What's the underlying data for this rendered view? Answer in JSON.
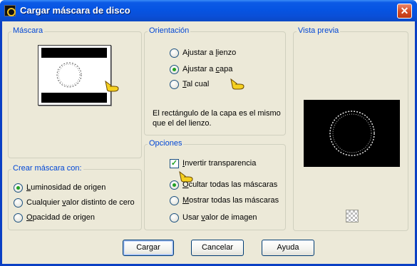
{
  "window": {
    "title": "Cargar máscara de disco",
    "close_symbol": "✕"
  },
  "mask_group": {
    "label": "Máscara"
  },
  "orientation_group": {
    "label": "Orientación",
    "options": [
      {
        "label_pre": "Ajustar a ",
        "mnemonic": "l",
        "label_post": "ienzo",
        "checked": false
      },
      {
        "label_pre": "Ajustar a ",
        "mnemonic": "c",
        "label_post": "apa",
        "checked": true
      },
      {
        "label_pre": "",
        "mnemonic": "T",
        "label_post": "al cual",
        "checked": false
      }
    ],
    "info_line1": "El rectángulo de la capa es el mismo",
    "info_line2": "que el del lienzo."
  },
  "preview_group": {
    "label": "Vista previa",
    "background_icon": "checkerboard-icon"
  },
  "create_mask_group": {
    "label": "Crear máscara con:",
    "options": [
      {
        "label_pre": "",
        "mnemonic": "L",
        "label_post": "uminosidad de origen",
        "checked": true
      },
      {
        "label_pre": "Cualquier ",
        "mnemonic": "v",
        "label_post": "alor distinto de cero",
        "checked": false
      },
      {
        "label_pre": "",
        "mnemonic": "O",
        "label_post": "pacidad de origen",
        "checked": false
      }
    ]
  },
  "options_group": {
    "label": "Opciones",
    "invert": {
      "label_pre": "",
      "mnemonic": "I",
      "label_post": "nvertir transparencia",
      "checked": true
    },
    "radios": [
      {
        "label_pre": "",
        "mnemonic": "O",
        "label_post": "cultar todas las máscaras",
        "checked": true
      },
      {
        "label_pre": "",
        "mnemonic": "M",
        "label_post": "ostrar todas las máscaras",
        "checked": false
      },
      {
        "label_pre": "Usar ",
        "mnemonic": "v",
        "label_post": "alor de imagen",
        "checked": false
      }
    ]
  },
  "buttons": {
    "load": "Cargar",
    "cancel": "Cancelar",
    "help": "Ayuda"
  },
  "colors": {
    "group_label": "#0046d5",
    "titlebar": "#0654e2",
    "dialog_bg": "#ece9d8",
    "radio_dot": "#21a121"
  }
}
